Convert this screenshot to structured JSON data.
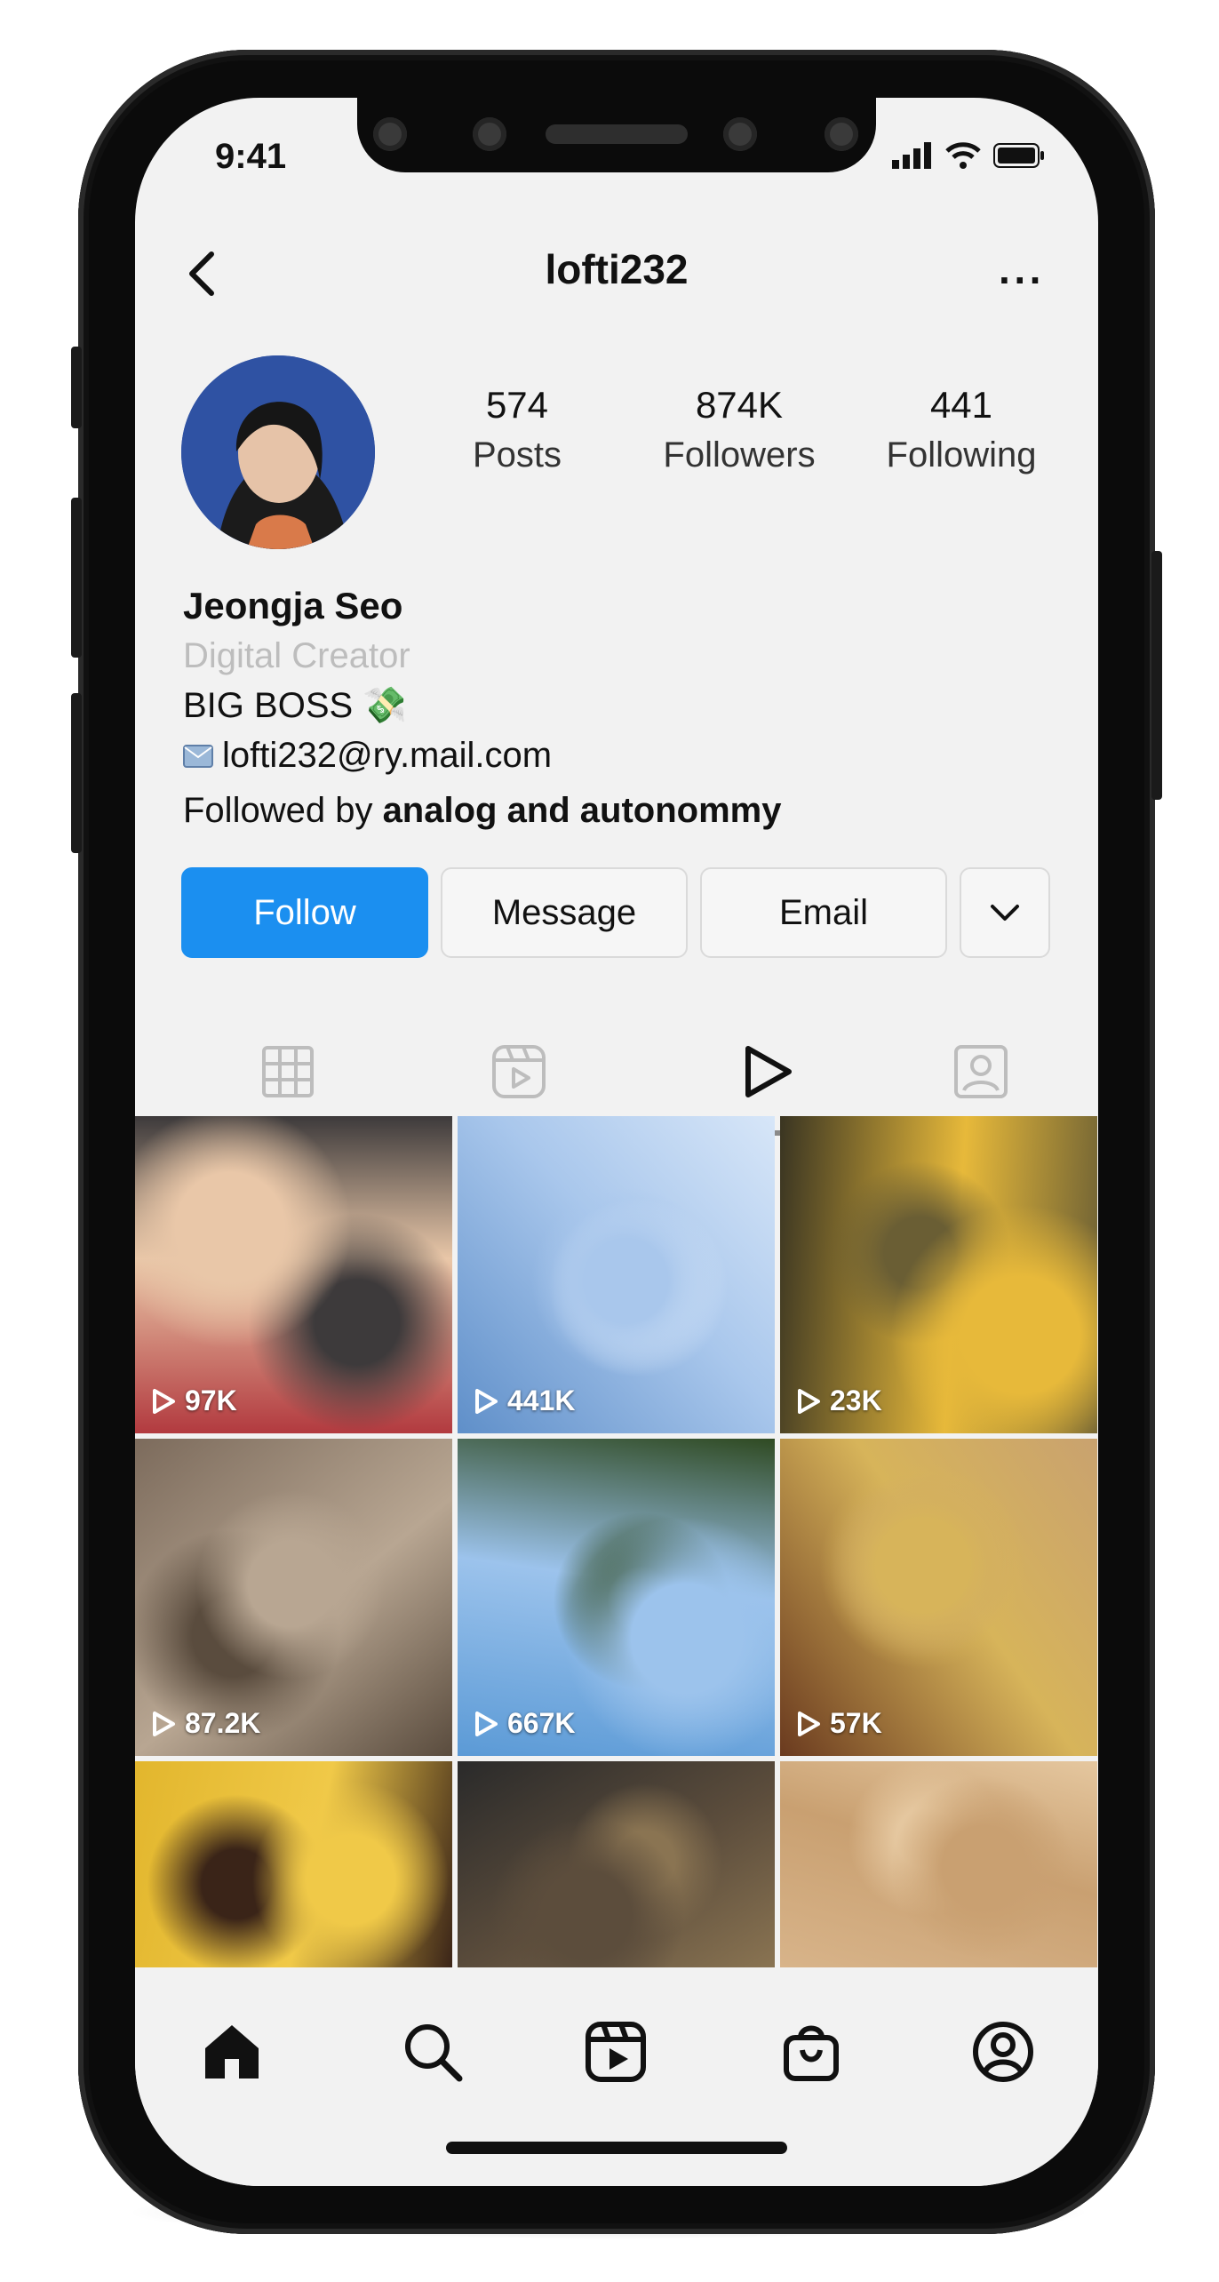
{
  "status_bar": {
    "time": "9:41"
  },
  "nav": {
    "title": "lofti232",
    "more": "···"
  },
  "profile": {
    "stats": [
      {
        "value": "574",
        "label": "Posts"
      },
      {
        "value": "874K",
        "label": "Followers"
      },
      {
        "value": "441",
        "label": "Following"
      }
    ],
    "name": "Jeongja Seo",
    "category": "Digital Creator",
    "bio": "BIG BOSS 💸",
    "email": "lofti232@ry.mail.com",
    "followed_by_prefix": "Followed by ",
    "followed_by_names": "analog and autonommy"
  },
  "actions": {
    "follow": "Follow",
    "message": "Message",
    "email": "Email"
  },
  "tabs": [
    "grid-icon",
    "reels-icon",
    "play-icon",
    "tagged-icon"
  ],
  "active_tab": "play-icon",
  "grid": [
    {
      "views": "97K",
      "colors": [
        "#b23a3f",
        "#e9c7a8",
        "#3d3a3b"
      ]
    },
    {
      "views": "441K",
      "colors": [
        "#5f8fc9",
        "#a9c7ec",
        "#d7e6f8"
      ]
    },
    {
      "views": "23K",
      "colors": [
        "#3a3522",
        "#e7b93a",
        "#6a5e34"
      ]
    },
    {
      "views": "87.2K",
      "colors": [
        "#7c6b5c",
        "#b8a692",
        "#5a4c3e"
      ]
    },
    {
      "views": "667K",
      "colors": [
        "#5b9ad6",
        "#9cc3ec",
        "#2f4a22"
      ]
    },
    {
      "views": "57K",
      "colors": [
        "#6a3a1f",
        "#d7b45a",
        "#c9a26f"
      ]
    },
    {
      "views": "",
      "colors": [
        "#e2b62d",
        "#f0c948",
        "#3a2418"
      ]
    },
    {
      "views": "",
      "colors": [
        "#2a2a2a",
        "#5c4d3c",
        "#8a7452"
      ]
    },
    {
      "views": "",
      "colors": [
        "#d8b48a",
        "#c9a071",
        "#e5c79f"
      ]
    }
  ],
  "bottom_nav": [
    "home-icon",
    "search-icon",
    "reels-icon",
    "shop-icon",
    "profile-icon"
  ]
}
